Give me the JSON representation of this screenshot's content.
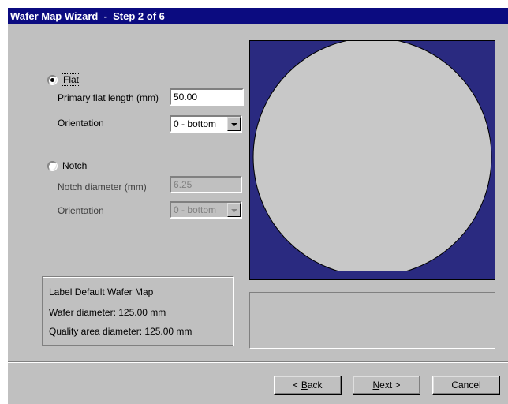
{
  "window": {
    "title": "Wafer Map Wizard  -  Step 2 of 6"
  },
  "flat": {
    "radio_label": "Flat",
    "selected": true,
    "length_label": "Primary flat length (mm)",
    "length_value": "50.00",
    "orientation_label": "Orientation",
    "orientation_value": "0 - bottom"
  },
  "notch": {
    "radio_label": "Notch",
    "selected": false,
    "diameter_label": "Notch diameter (mm)",
    "diameter_value": "6.25",
    "orientation_label": "Orientation",
    "orientation_value": "0 - bottom"
  },
  "info": {
    "label": "Label Default Wafer Map",
    "wafer_diameter": "Wafer diameter: 125.00 mm",
    "quality_area": "Quality area diameter: 125.00 mm"
  },
  "preview": {
    "background": "#2a2a80",
    "wafer_color": "#c8c8c8"
  },
  "buttons": {
    "back_prefix": "< ",
    "back_mnemonic": "B",
    "back_rest": "ack",
    "next_mnemonic": "N",
    "next_rest": "ext >",
    "cancel": "Cancel"
  }
}
